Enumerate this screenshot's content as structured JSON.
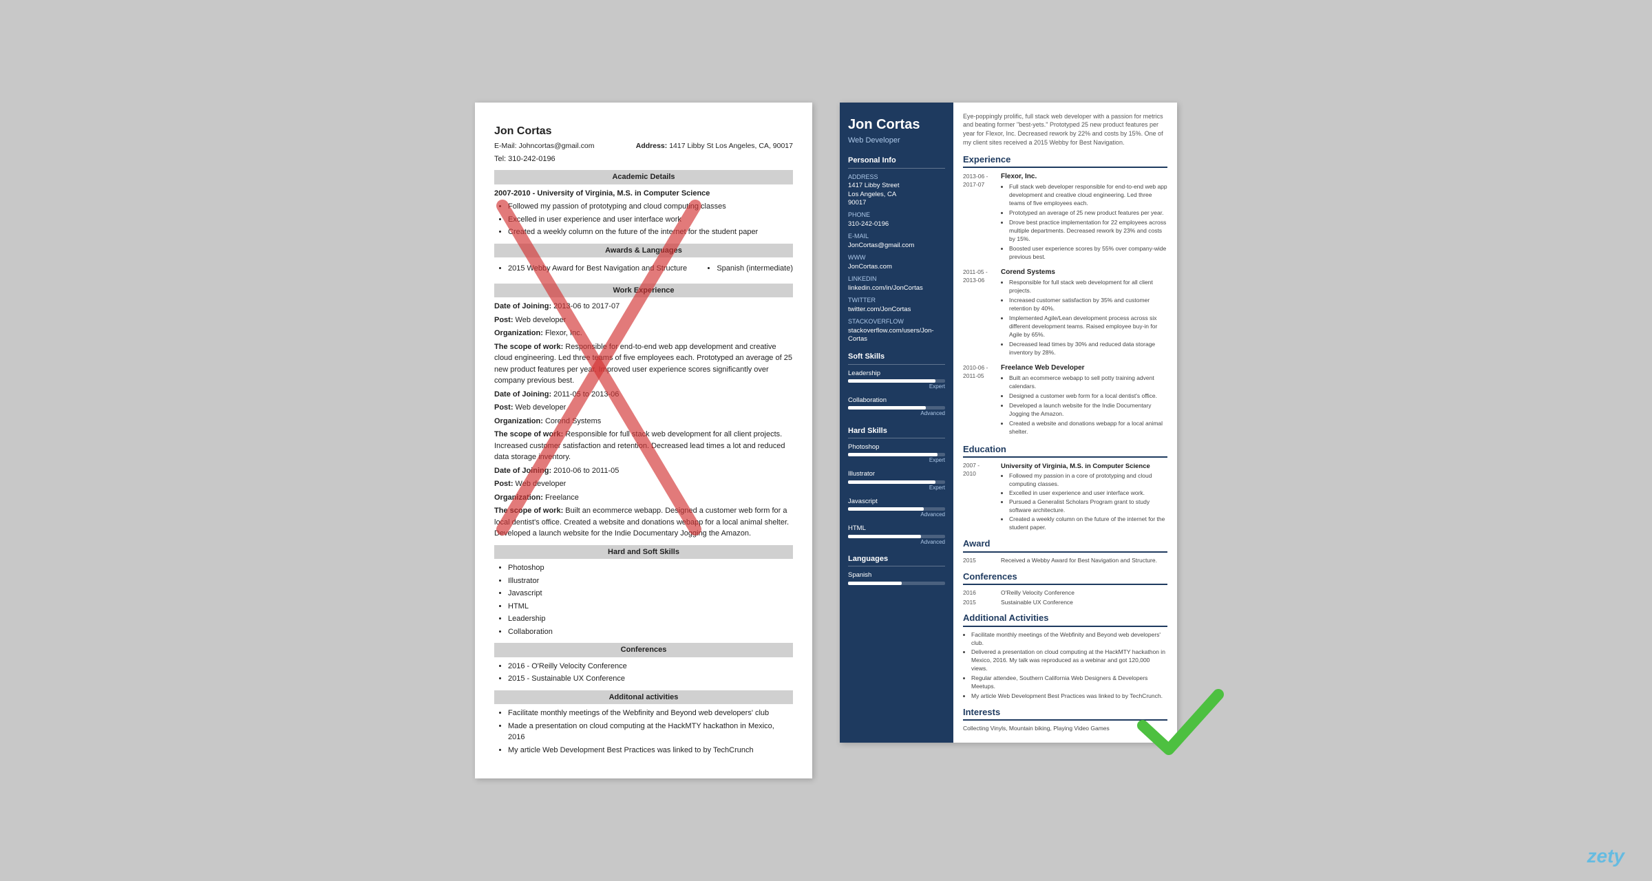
{
  "left_resume": {
    "name": "Jon Cortas",
    "email": "E-Mail: Johncortas@gmail.com",
    "tel": "Tel: 310-242-0196",
    "address_label": "Address:",
    "address": "1417 Libby St Los Angeles, CA, 90017",
    "sections": {
      "academic": {
        "title": "Academic Details",
        "items": [
          "2007-2010 - University of Virginia, M.S. in Computer Science",
          "Followed my passion of prototyping and cloud computing classes",
          "Excelled in user experience and user interface work",
          "Created a weekly column on the future of the internet for the student paper"
        ]
      },
      "awards": {
        "title": "Awards & Languages",
        "award": "2015 Webby Award for Best Navigation and Structure",
        "language": "Spanish (intermediate)"
      },
      "work": {
        "title": "Work Experience",
        "jobs": [
          {
            "date_label": "Date of Joining:",
            "date": "2013-06 to 2017-07",
            "post_label": "Post:",
            "post": "Web developer",
            "org_label": "Organization:",
            "org": "Flexor, Inc.",
            "scope_label": "The scope of work:",
            "scope": "Responsible for end-to-end web app development and creative cloud engineering. Led three teams of five employees each. Prototyped an average of 25 new product features per year. Improved user experience scores significantly over company previous best."
          },
          {
            "date_label": "Date of Joining:",
            "date": "2011-05 to 2013-06",
            "post_label": "Post:",
            "post": "Web developer",
            "org_label": "Organization:",
            "org": "Corend Systems",
            "scope_label": "The scope of work:",
            "scope": "Responsible for full stack web development for all client projects. Increased customer satisfaction and retention. Decreased lead times a lot and reduced data storage inventory."
          },
          {
            "date_label": "Date of Joining:",
            "date": "2010-06 to 2011-05",
            "post_label": "Post:",
            "post": "Web developer",
            "org_label": "Organization:",
            "org": "Freelance",
            "scope_label": "The scope of work:",
            "scope": "Built an ecommerce webapp. Designed a customer web form for a local dentist's office. Created a website and donations webapp for a local animal shelter. Developed a launch website for the Indie Documentary Jogging the Amazon."
          }
        ]
      },
      "skills": {
        "title": "Hard and Soft Skills",
        "items": [
          "Photoshop",
          "Illustrator",
          "Javascript",
          "HTML",
          "Leadership",
          "Collaboration"
        ]
      },
      "conferences": {
        "title": "Conferences",
        "items": [
          "2016 - O'Reilly Velocity Conference",
          "2015 - Sustainable UX Conference"
        ]
      },
      "activities": {
        "title": "Additonal activities",
        "items": [
          "Facilitate monthly meetings of the Webfinity and Beyond web developers' club",
          "Made a presentation on cloud computing at the HackMTY hackathon in Mexico, 2016",
          "My article Web Development Best Practices was linked to by TechCrunch"
        ]
      }
    }
  },
  "right_resume": {
    "name": "Jon Cortas",
    "title": "Web Developer",
    "intro": "Eye-poppingly prolific, full stack web developer with a passion for metrics and beating former \"best-yets.\" Prototyped 25 new product features per year for Flexor, Inc. Decreased rework by 22% and costs by 15%. One of my client sites received a 2015 Webby for Best Navigation.",
    "sidebar": {
      "personal_info_title": "Personal Info",
      "address_label": "Address",
      "address_lines": [
        "1417 Libby Street",
        "Los Angeles, CA",
        "90017"
      ],
      "phone_label": "Phone",
      "phone": "310-242-0196",
      "email_label": "E-mail",
      "email": "JonCortas@gmail.com",
      "www_label": "WWW",
      "www": "JonCortas.com",
      "linkedin_label": "LinkedIn",
      "linkedin": "linkedin.com/in/JonCortas",
      "twitter_label": "Twitter",
      "twitter": "twitter.com/JonCortas",
      "stackoverflow_label": "StackOverflow",
      "stackoverflow": "stackoverflow.com/users/Jon-Cortas",
      "soft_skills_title": "Soft Skills",
      "soft_skills": [
        {
          "name": "Leadership",
          "level": 90,
          "label": "Expert"
        },
        {
          "name": "Collaboration",
          "level": 80,
          "label": "Advanced"
        }
      ],
      "hard_skills_title": "Hard Skills",
      "hard_skills": [
        {
          "name": "Photoshop",
          "level": 92,
          "label": "Expert"
        },
        {
          "name": "Illustrator",
          "level": 90,
          "label": "Expert"
        },
        {
          "name": "Javascript",
          "level": 78,
          "label": "Advanced"
        },
        {
          "name": "HTML",
          "level": 75,
          "label": "Advanced"
        }
      ],
      "languages_title": "Languages",
      "languages": [
        {
          "name": "Spanish",
          "level": 55,
          "label": ""
        }
      ]
    },
    "experience": {
      "title": "Experience",
      "jobs": [
        {
          "dates": "2013-06 -\n2017-07",
          "company": "Flexor, Inc.",
          "points": [
            "Full stack web developer responsible for end-to-end web app development and creative cloud engineering. Led three teams of five employees each.",
            "Prototyped an average of 25 new product features per year.",
            "Drove best practice implementation for 22 employees across multiple departments. Decreased rework by 23% and costs by 15%.",
            "Boosted user experience scores by 55% over company-wide previous best."
          ]
        },
        {
          "dates": "2011-05 -\n2013-06",
          "company": "Corend Systems",
          "points": [
            "Responsible for full stack web development for all client projects.",
            "Increased customer satisfaction by 35% and customer retention by 40%.",
            "Implemented Agile/Lean development process across six different development teams. Raised employee buy-in for Agile by 65%.",
            "Decreased lead times by 30% and reduced data storage inventory by 28%."
          ]
        },
        {
          "dates": "2010-06 -\n2011-05",
          "company": "Freelance Web Developer",
          "points": [
            "Built an ecommerce webapp to sell potty training advent calendars.",
            "Designed a customer web form for a local dentist's office.",
            "Developed a launch website for the Indie Documentary Jogging the Amazon.",
            "Created a website and donations webapp for a local animal shelter."
          ]
        }
      ]
    },
    "education": {
      "title": "Education",
      "items": [
        {
          "dates": "2007 -\n2010",
          "degree": "University of Virginia, M.S. in Computer Science",
          "points": [
            "Followed my passion in a core of prototyping and cloud computing classes.",
            "Excelled in user experience and user interface work.",
            "Pursued a Generalist Scholars Program grant to study software architecture.",
            "Created a weekly column on the future of the internet for the student paper."
          ]
        }
      ]
    },
    "award": {
      "title": "Award",
      "year": "2015",
      "text": "Received a Webby Award for Best Navigation and Structure."
    },
    "conferences": {
      "title": "Conferences",
      "items": [
        {
          "year": "2016",
          "name": "O'Reilly Velocity Conference"
        },
        {
          "year": "2015",
          "name": "Sustainable UX Conference"
        }
      ]
    },
    "activities": {
      "title": "Additional Activities",
      "items": [
        "Facilitate monthly meetings of the Webfinity and Beyond web developers' club.",
        "Delivered a presentation on cloud computing at the HackMTY hackathon in Mexico, 2016. My talk was reproduced as a webinar and got 120,000 views.",
        "Regular attendee, Southern California Web Designers & Developers Meetups.",
        "My article Web Development Best Practices was linked to by TechCrunch."
      ]
    },
    "interests": {
      "title": "Interests",
      "text": "Collecting Vinyls, Mountain biking, Playing Video Games"
    }
  },
  "brand": "zety"
}
